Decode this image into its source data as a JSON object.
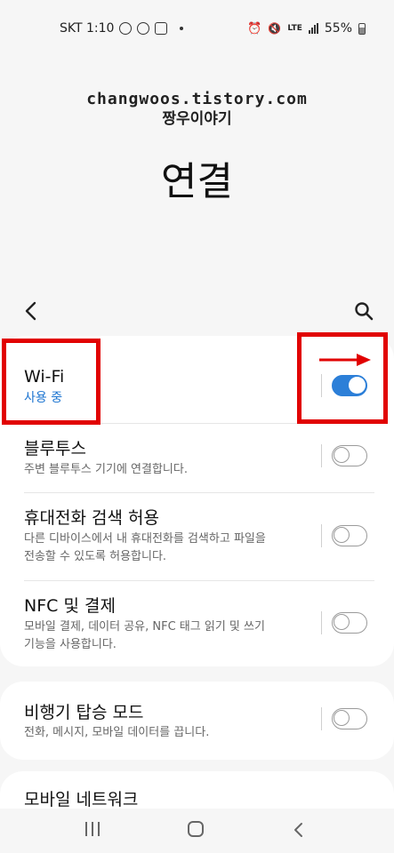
{
  "status_bar": {
    "carrier_time": "SKT 1:10",
    "battery": "55%",
    "network": "LTE"
  },
  "watermark": {
    "line1": "changwoos.tistory.com",
    "line2": "짱우이야기"
  },
  "page": {
    "title": "연결"
  },
  "icons": {
    "back": "chevron-left-icon",
    "search": "search-icon"
  },
  "settings": {
    "wifi": {
      "title": "Wi-Fi",
      "status": "사용 중",
      "enabled": true
    },
    "bluetooth": {
      "title": "블루투스",
      "desc": "주변 블루투스 기기에 연결합니다.",
      "enabled": false
    },
    "visibility": {
      "title": "휴대전화 검색 허용",
      "desc1": "다른 디바이스에서 내 휴대전화를 검색하고 파일을",
      "desc2": "전송할 수 있도록 허용합니다.",
      "enabled": false
    },
    "nfc": {
      "title": "NFC 및 결제",
      "desc1": "모바일 결제, 데이터 공유, NFC 태그 읽기 및 쓰기",
      "desc2": "기능을 사용합니다.",
      "enabled": false
    },
    "airplane": {
      "title": "비행기 탑승 모드",
      "desc": "전화, 메시지, 모바일 데이터를 끕니다.",
      "enabled": false
    },
    "mobile_network": {
      "title": "모바일 네트워크"
    }
  },
  "colors": {
    "accent": "#2c7fd8",
    "status_blue": "#1a73d0",
    "highlight": "#e10000"
  }
}
